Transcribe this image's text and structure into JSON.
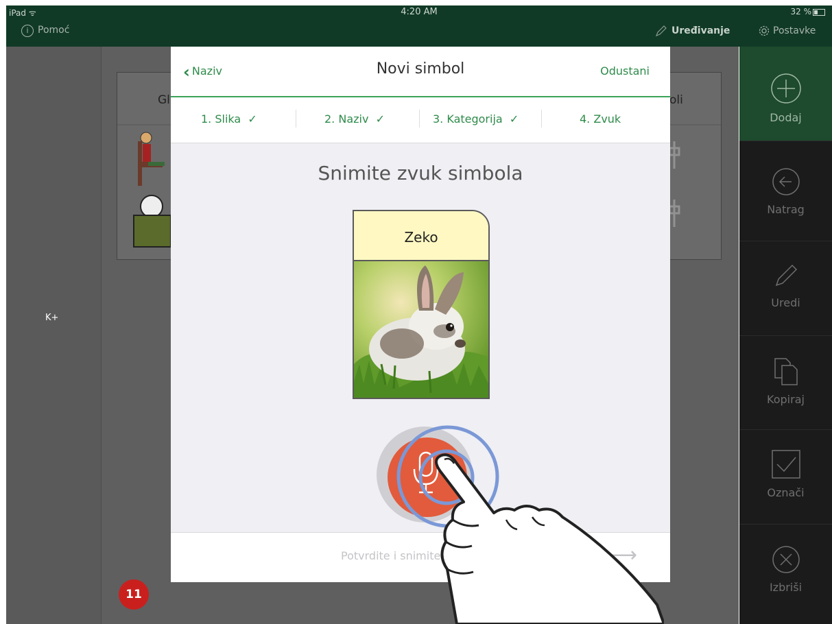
{
  "status_bar": {
    "device": "iPad",
    "time": "4:20 AM",
    "battery": "32 %"
  },
  "top_bar": {
    "help_label": "Pomoć",
    "edit_mode_label": "Uređivanje",
    "settings_label": "Postavke"
  },
  "background": {
    "left_label": "K+",
    "card_label_left": "Gl",
    "card_label_right": "oli",
    "badge": "11"
  },
  "sidebar": {
    "items": [
      {
        "label": "Dodaj",
        "icon": "plus-circle-icon",
        "active": true
      },
      {
        "label": "Natrag",
        "icon": "arrow-left-circle-icon"
      },
      {
        "label": "Uredi",
        "icon": "pencil-icon"
      },
      {
        "label": "Kopiraj",
        "icon": "copy-icon"
      },
      {
        "label": "Označi",
        "icon": "checkbox-icon"
      },
      {
        "label": "Izbriši",
        "icon": "x-circle-icon"
      }
    ]
  },
  "modal": {
    "back_label": "Naziv",
    "title": "Novi simbol",
    "cancel_label": "Odustani",
    "steps": [
      {
        "label": "1. Slika",
        "done": true
      },
      {
        "label": "2. Naziv",
        "done": true
      },
      {
        "label": "3. Kategorija",
        "done": true
      },
      {
        "label": "4. Zvuk",
        "done": false
      }
    ],
    "heading": "Snimite zvuk simbola",
    "symbol_label": "Zeko",
    "record_icon": "microphone-icon",
    "confirm_label": "Potvrdite i snimite sim",
    "next_icon": "arrow-right-icon"
  },
  "colors": {
    "accent_green": "#2e8b4a",
    "record_red": "#e25b3c",
    "ripple_blue": "#7b98d6",
    "symbol_label_bg": "#fff8c2"
  }
}
